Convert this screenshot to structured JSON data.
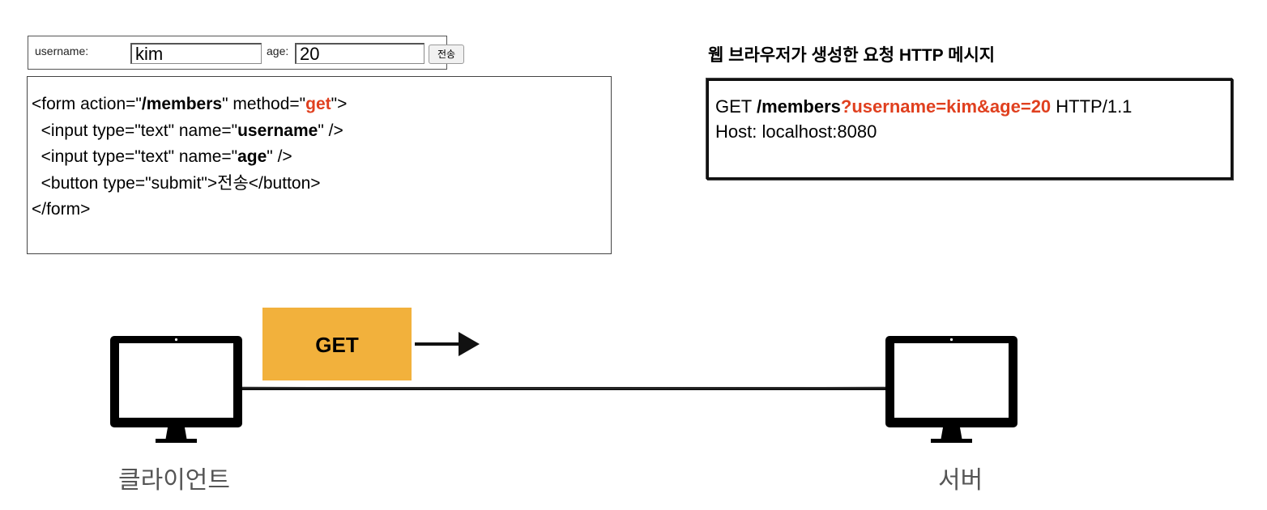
{
  "form_demo": {
    "username_label": "username:",
    "username_value": "kim",
    "age_label": "age:",
    "age_value": "20",
    "submit_label": "전송"
  },
  "code": {
    "l1_a": "<form action=\"",
    "l1_b": "/members",
    "l1_c": "\" method=\"",
    "l1_d": "get",
    "l1_e": "\">",
    "l2_a": "  <input type=\"text\" name=\"",
    "l2_b": "username",
    "l2_c": "\" />",
    "l3_a": "  <input type=\"text\" name=\"",
    "l3_b": "age",
    "l3_c": "\" />",
    "l4": "  <button type=\"submit\">전송</button>",
    "l5": "</form>"
  },
  "http_message": {
    "title": "웹 브라우저가 생성한 요청 HTTP 메시지",
    "method": "GET ",
    "path": "/members",
    "query": "?username=kim&age=20",
    "version": " HTTP/1.1",
    "host": "Host: localhost:8080"
  },
  "diagram": {
    "request_label": "GET",
    "client_label": "클라이언트",
    "server_label": "서버"
  },
  "colors": {
    "accent_red": "#e0401f",
    "get_box": "#f2b13c",
    "caption": "#555555"
  },
  "icons": [
    "monitor-icon",
    "arrow-right-icon"
  ]
}
